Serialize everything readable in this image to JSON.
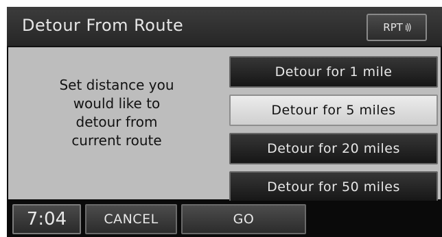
{
  "header": {
    "title": "Detour From Route",
    "rpt_label": "RPT",
    "rpt_icon": "speaker-waves-icon"
  },
  "main": {
    "prompt": "Set distance you\nwould like to\ndetour from\ncurrent route",
    "options": [
      {
        "label": "Detour for 1 mile",
        "selected": false
      },
      {
        "label": "Detour for 5 miles",
        "selected": true
      },
      {
        "label": "Detour for 20 miles",
        "selected": false
      },
      {
        "label": "Detour for 50 miles",
        "selected": false
      }
    ]
  },
  "footer": {
    "time": "7:04",
    "cancel_label": "CANCEL",
    "go_label": "GO"
  },
  "colors": {
    "panel_background": "#bdbdbd",
    "button_dark": "#262626",
    "button_selected": "#dcdcdc",
    "text_light": "#e8e8e8"
  }
}
